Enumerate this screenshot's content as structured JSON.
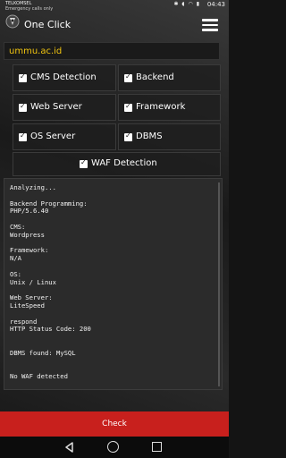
{
  "statusbar": {
    "carrier": "TELKOMSEL",
    "carrier_sub": "Emergency calls only",
    "time": "04:43",
    "icons": [
      "bluetooth-icon",
      "volume-icon",
      "wifi-icon",
      "battery-icon"
    ]
  },
  "app": {
    "title": "One Click"
  },
  "target": {
    "value": "ummu.ac.id"
  },
  "options": [
    {
      "label": "CMS Detection",
      "checked": true
    },
    {
      "label": "Backend",
      "checked": true
    },
    {
      "label": "Web Server",
      "checked": true
    },
    {
      "label": "Framework",
      "checked": true
    },
    {
      "label": "OS Server",
      "checked": true
    },
    {
      "label": "DBMS",
      "checked": true
    },
    {
      "label": "WAF Detection",
      "checked": true
    }
  ],
  "output": {
    "text": "Analyzing...\n\nBackend Programming:\nPHP/5.6.40\n\nCMS:\nWordpress\n\nFramework:\nN/A\n\nOS:\nUnix / Linux\n\nWeb Server:\nLiteSpeed\n\nrespond\nHTTP Status Code: 200\n\n\nDBMS found: MySQL\n\n\nNo WAF detected"
  },
  "actions": {
    "check_label": "Check"
  },
  "colors": {
    "accent": "#c8201d",
    "target_text": "#f1c40f"
  }
}
